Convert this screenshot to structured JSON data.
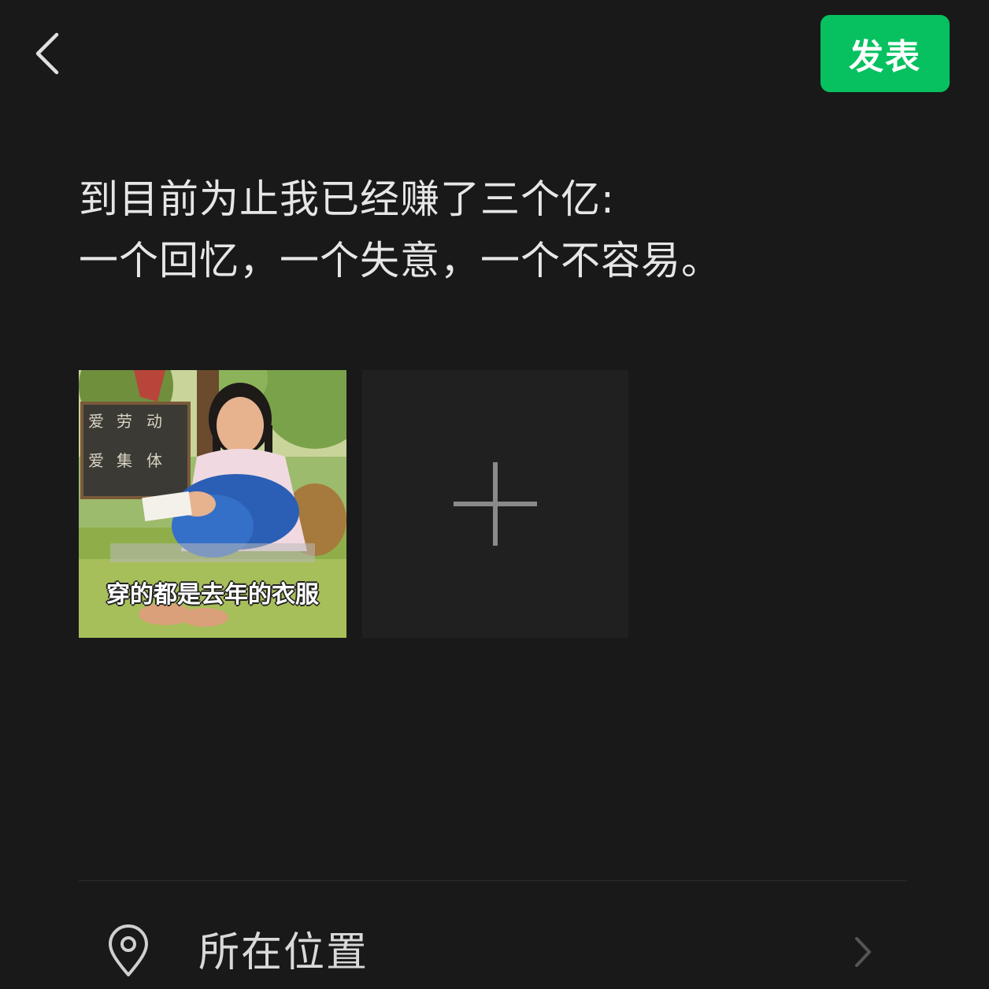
{
  "header": {
    "post_label": "发表",
    "accent_color": "#07c160",
    "back_icon": "chevron-left-icon"
  },
  "post": {
    "lines": [
      "到目前为止我已经赚了三个亿:",
      "一个回忆，一个失意，一个不容易。"
    ]
  },
  "images": {
    "photo_caption": "穿的都是去年的衣服",
    "add_icon": "plus-icon"
  },
  "location": {
    "label": "所在位置",
    "icon": "location-pin-icon",
    "chevron_icon": "chevron-right-icon"
  }
}
